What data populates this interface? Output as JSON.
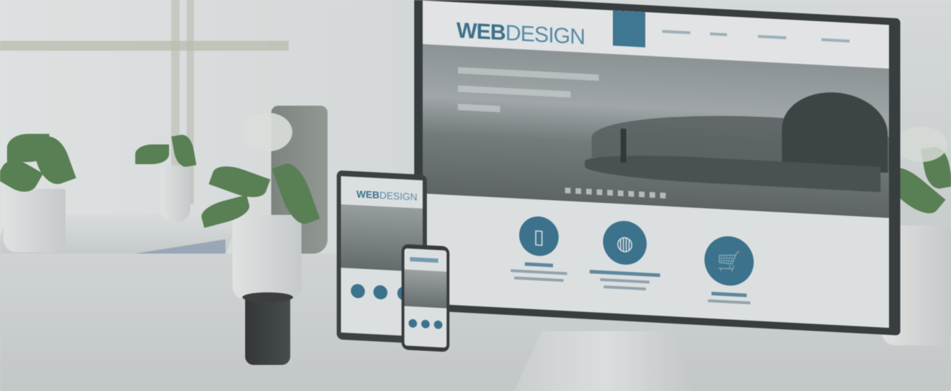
{
  "photo": {
    "monitor_site": {
      "logo_bold": "WEB",
      "logo_light": "DESIGN"
    },
    "tablet_site": {
      "logo_bold": "WEB",
      "logo_light": "DESIGN"
    },
    "colors": {
      "brand_blue": "#2c6b8c",
      "logo_light_blue": "#4d8aab",
      "plant_green": "#4f7a46",
      "cup_black": "#202223"
    },
    "icons": {
      "feature_1": "smartphone-icon",
      "feature_2": "globe-icon",
      "feature_3": "shopping-cart-icon"
    }
  }
}
